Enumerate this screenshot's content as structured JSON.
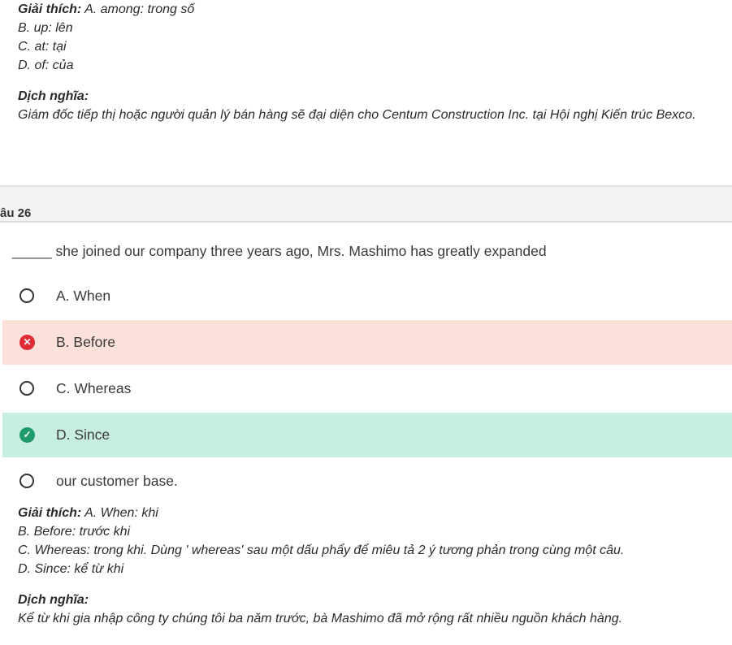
{
  "prev_explanation": {
    "heading": "Giải thích:",
    "first": " A. among: trong số",
    "lines": [
      "B. up: lên",
      "C. at: tại",
      "D. of: của"
    ],
    "translation_heading": "Dịch nghĩa:",
    "translation": "Giám đốc tiếp thị hoặc người quản lý bán hàng sẽ đại diện cho Centum Construction Inc. tại Hội nghị Kiến trúc Bexco."
  },
  "question": {
    "label": "âu 26",
    "stem": "_____ she joined our company three years ago, Mrs. Mashimo has greatly expanded",
    "options": [
      {
        "text": "A. When",
        "state": "none"
      },
      {
        "text": "B. Before",
        "state": "wrong"
      },
      {
        "text": "C. Whereas",
        "state": "none"
      },
      {
        "text": "D. Since",
        "state": "correct"
      },
      {
        "text": "our customer base.",
        "state": "none"
      }
    ]
  },
  "explanation": {
    "heading": "Giải thích:",
    "first": " A. When: khi",
    "lines": [
      "B. Before: trước khi",
      "C. Whereas: trong khi. Dùng ' whereas' sau một dấu phẩy để miêu tả 2 ý tương phản trong cùng một câu.",
      "D. Since: kể từ khi"
    ],
    "translation_heading": "Dịch nghĩa:",
    "translation": "Kể từ khi gia nhập công ty chúng tôi ba năm trước, bà Mashimo đã mở rộng rất nhiều nguồn khách hàng."
  },
  "colors": {
    "wrong_bg": "#fce0da",
    "correct_bg": "#c8eee2",
    "wrong_icon": "#e02a36",
    "correct_icon": "#1f9a6b"
  },
  "icons": {
    "wrong": "x-circle-icon",
    "correct": "check-circle-icon",
    "unselected": "radio-empty-icon"
  }
}
